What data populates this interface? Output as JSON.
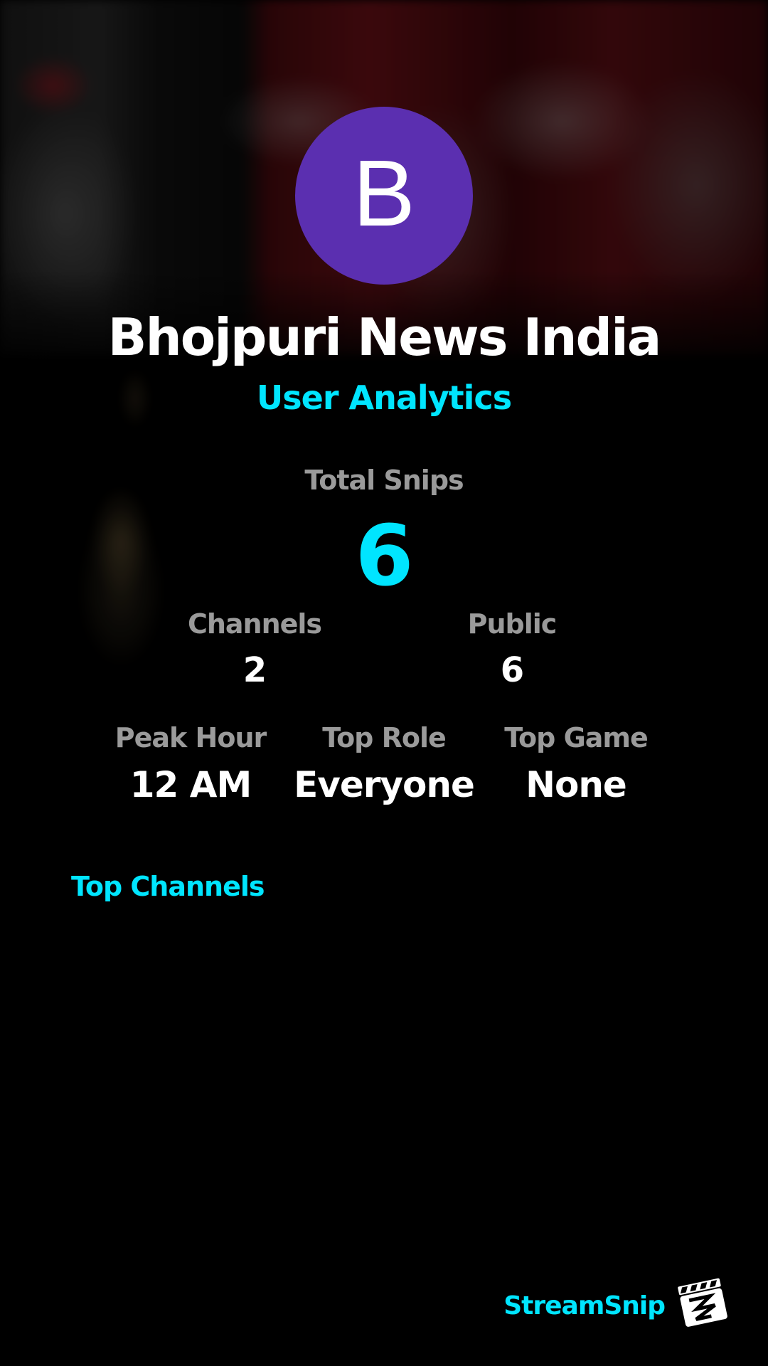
{
  "profile": {
    "avatar_letter": "B",
    "avatar_color": "#5b2fb0",
    "name": "Bhojpuri News India",
    "subtitle": "User Analytics"
  },
  "stats": {
    "total": {
      "label": "Total Snips",
      "value": "6"
    },
    "channels": {
      "label": "Channels",
      "value": "2"
    },
    "public": {
      "label": "Public",
      "value": "6"
    },
    "peak_hour": {
      "label": "Peak Hour",
      "value": "12 AM"
    },
    "top_role": {
      "label": "Top Role",
      "value": "Everyone"
    },
    "top_game": {
      "label": "Top Game",
      "value": "None"
    }
  },
  "sections": {
    "top_channels": "Top Channels"
  },
  "footer": {
    "brand": "StreamSnip",
    "logo_icon": "clapperboard-icon"
  },
  "colors": {
    "accent": "#00e5ff",
    "background": "#000000",
    "label": "#9a9a9a",
    "value": "#ffffff"
  }
}
